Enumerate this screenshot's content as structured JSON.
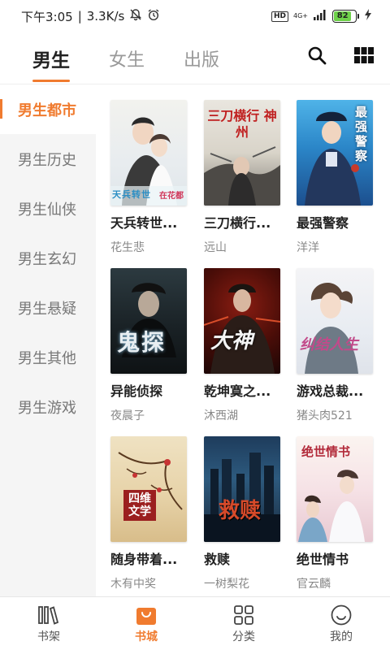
{
  "status_bar": {
    "time": "下午3:05",
    "speed": "3.3K/s",
    "hd": "HD",
    "network": "4G+",
    "battery": "82"
  },
  "top_tabs": [
    "男生",
    "女生",
    "出版"
  ],
  "sidebar": [
    "男生都市",
    "男生历史",
    "男生仙侠",
    "男生玄幻",
    "男生悬疑",
    "男生其他",
    "男生游戏"
  ],
  "books": [
    {
      "title": "天兵转世...",
      "author": "花生悲"
    },
    {
      "title": "三刀横行...",
      "author": "远山"
    },
    {
      "title": "最强警察",
      "author": "洋洋"
    },
    {
      "title": "异能侦探",
      "author": "夜晨子"
    },
    {
      "title": "乾坤寞之...",
      "author": "沐西湖"
    },
    {
      "title": "游戏总裁...",
      "author": "猪头肉521"
    },
    {
      "title": "随身带着...",
      "author": "木有中奖"
    },
    {
      "title": "救赎",
      "author": "一树梨花"
    },
    {
      "title": "绝世情书",
      "author": "官云麟"
    }
  ],
  "cover_text": {
    "c1a": "天兵转世",
    "c1b": "在花都",
    "c2": "三刀横行 神州",
    "c3": "最强警察",
    "c4": "鬼探",
    "c5": "大神",
    "c6": "纠结人生",
    "c7": "四维文学",
    "c8": "救赎",
    "c9": "绝世情书"
  },
  "bottom_nav": [
    {
      "label": "书架",
      "icon": "bookshelf-icon"
    },
    {
      "label": "书城",
      "icon": "store-bag-icon"
    },
    {
      "label": "分类",
      "icon": "category-grid-icon"
    },
    {
      "label": "我的",
      "icon": "smiley-profile-icon"
    }
  ],
  "colors": {
    "accent": "#f07b2f",
    "sidebar_bg": "#f5f5f5"
  }
}
